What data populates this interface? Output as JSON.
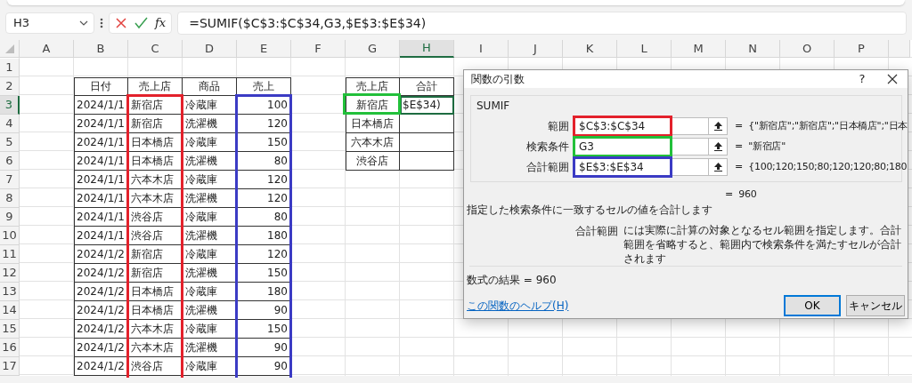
{
  "formula_bar": {
    "name_box": "H3",
    "function_label": "fx",
    "formula": "=SUMIF($C$3:$C$34,G3,$E$3:$E$34)"
  },
  "sheet": {
    "columns": [
      {
        "label": "A",
        "selected": false
      },
      {
        "label": "B",
        "selected": false
      },
      {
        "label": "C",
        "selected": false
      },
      {
        "label": "D",
        "selected": false
      },
      {
        "label": "E",
        "selected": false
      },
      {
        "label": "F",
        "selected": false
      },
      {
        "label": "G",
        "selected": false
      },
      {
        "label": "H",
        "selected": true
      },
      {
        "label": "I",
        "selected": false
      },
      {
        "label": "J",
        "selected": false
      },
      {
        "label": "K",
        "selected": false
      },
      {
        "label": "L",
        "selected": false
      },
      {
        "label": "M",
        "selected": false
      },
      {
        "label": "N",
        "selected": false
      },
      {
        "label": "O",
        "selected": false
      },
      {
        "label": "P",
        "selected": false
      }
    ],
    "rows": [
      {
        "label": "1",
        "selected": false
      },
      {
        "label": "2",
        "selected": false
      },
      {
        "label": "3",
        "selected": true
      },
      {
        "label": "4",
        "selected": false
      },
      {
        "label": "5",
        "selected": false
      },
      {
        "label": "6",
        "selected": false
      },
      {
        "label": "7",
        "selected": false
      },
      {
        "label": "8",
        "selected": false
      },
      {
        "label": "9",
        "selected": false
      },
      {
        "label": "10",
        "selected": false
      },
      {
        "label": "11",
        "selected": false
      },
      {
        "label": "12",
        "selected": false
      },
      {
        "label": "13",
        "selected": false
      },
      {
        "label": "14",
        "selected": false
      },
      {
        "label": "15",
        "selected": false
      },
      {
        "label": "16",
        "selected": false
      },
      {
        "label": "17",
        "selected": false
      }
    ]
  },
  "sales_table": {
    "columns": [
      {
        "label": "日付"
      },
      {
        "label": "売上店",
        "color": "#e3212b"
      },
      {
        "label": "商品"
      },
      {
        "label": "売上",
        "color": "#3b3bc4"
      }
    ],
    "rows": [
      [
        "2024/1/1",
        "新宿店",
        "冷蔵庫",
        "100"
      ],
      [
        "2024/1/1",
        "新宿店",
        "洗濯機",
        "120"
      ],
      [
        "2024/1/1",
        "日本橋店",
        "冷蔵庫",
        "150"
      ],
      [
        "2024/1/1",
        "日本橋店",
        "洗濯機",
        "80"
      ],
      [
        "2024/1/1",
        "六本木店",
        "冷蔵庫",
        "120"
      ],
      [
        "2024/1/1",
        "六本木店",
        "洗濯機",
        "120"
      ],
      [
        "2024/1/1",
        "渋谷店",
        "冷蔵庫",
        "80"
      ],
      [
        "2024/1/1",
        "渋谷店",
        "洗濯機",
        "180"
      ],
      [
        "2024/1/2",
        "新宿店",
        "冷蔵庫",
        "120"
      ],
      [
        "2024/1/2",
        "新宿店",
        "洗濯機",
        "150"
      ],
      [
        "2024/1/2",
        "日本橋店",
        "冷蔵庫",
        "180"
      ],
      [
        "2024/1/2",
        "日本橋店",
        "洗濯機",
        "90"
      ],
      [
        "2024/1/2",
        "六本木店",
        "冷蔵庫",
        "150"
      ],
      [
        "2024/1/2",
        "六本木店",
        "洗濯機",
        "90"
      ],
      [
        "2024/1/2",
        "渋谷店",
        "冷蔵庫",
        "90"
      ]
    ]
  },
  "summary_table": {
    "columns": [
      {
        "label": "売上店"
      },
      {
        "label": "合計"
      }
    ],
    "rows": [
      [
        {
          "text": "新宿店",
          "selected": false,
          "color": "#22c03a"
        },
        {
          "text": "$E$34)",
          "selected": true
        }
      ],
      [
        {
          "text": "日本橋店",
          "selected": false
        },
        {
          "selected": false
        }
      ],
      [
        {
          "text": "六本木店",
          "selected": false
        },
        {
          "selected": false
        }
      ],
      [
        {
          "text": "渋谷店",
          "selected": false
        },
        {
          "selected": false
        }
      ]
    ]
  },
  "dialog": {
    "title": "関数の引数",
    "help": "?",
    "function_name": "SUMIF",
    "arguments": [
      {
        "label": "範囲",
        "value": "$C$3:$C$34",
        "color": "#e3212b",
        "result": "=  {\"新宿店\";\"新宿店\";\"日本橋店\";\"日本"
      },
      {
        "label": "検索条件",
        "value": "G3",
        "color": "#22c03a",
        "result": "=  \"新宿店\""
      },
      {
        "label": "合計範囲",
        "value": "$E$3:$E$34",
        "color": "#3b3bc4",
        "result": "=  {100;120;150;80;120;120;80;180"
      }
    ],
    "total": "=  960",
    "description": "指定した検索条件に一致するセルの値を合計します",
    "argument_help": {
      "name": "合計範囲",
      "text": "には実際に計算の対象となるセル範囲を指定します。合計範囲を省略すると、範囲内で検索条件を満たすセルが合計されます"
    },
    "formula_result": "数式の結果 =   960",
    "help_link": "この関数のヘルプ(H)",
    "buttons": [
      {
        "label": "OK",
        "default": true
      },
      {
        "label": "キャンセル",
        "default": false
      }
    ]
  }
}
